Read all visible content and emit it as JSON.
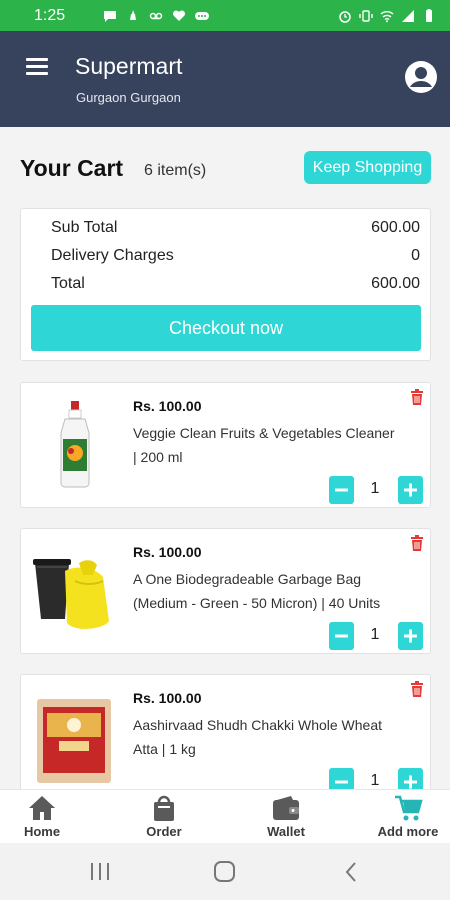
{
  "status_bar": {
    "time": "1:25",
    "background": "#2cb34a",
    "left_icons": [
      "message-icon",
      "notification-icon",
      "voicemail-icon",
      "health-icon",
      "overflow-icon"
    ],
    "right_icons": [
      "alarm-icon",
      "vibrate-icon",
      "wifi-icon",
      "signal-icon",
      "battery-icon"
    ]
  },
  "header": {
    "title": "Supermart",
    "location": "Gurgaon Gurgaon",
    "background": "#37435c"
  },
  "cart": {
    "title": "Your Cart",
    "item_count": "6 item(s)",
    "keep_shopping_label": "Keep Shopping"
  },
  "summary": {
    "subtotal_label": "Sub Total",
    "subtotal_value": "600.00",
    "delivery_label": "Delivery Charges",
    "delivery_value": "0",
    "total_label": "Total",
    "total_value": "600.00",
    "checkout_label": "Checkout now"
  },
  "products": [
    {
      "price": "Rs. 100.00",
      "name_line1": "Veggie Clean Fruits & Vegetables Cleaner",
      "name_line2": "| 200 ml",
      "quantity": "1"
    },
    {
      "price": "Rs. 100.00",
      "name_line1": "A One Biodegradeable Garbage Bag",
      "name_line2": "(Medium - Green - 50 Micron) | 40 Units",
      "quantity": "1"
    },
    {
      "price": "Rs. 100.00",
      "name_line1": "Aashirvaad Shudh Chakki Whole Wheat",
      "name_line2": "Atta | 1 kg",
      "quantity": "1"
    }
  ],
  "bottom_nav": {
    "items": [
      {
        "label": "Home",
        "icon": "home-icon"
      },
      {
        "label": "Order",
        "icon": "shopping-bag-icon"
      },
      {
        "label": "Wallet",
        "icon": "wallet-icon"
      },
      {
        "label": "Add more",
        "icon": "cart-icon"
      }
    ]
  },
  "colors": {
    "accent": "#2ed6d6",
    "delete": "#e53935",
    "cart_icon": "#26b5b5"
  }
}
